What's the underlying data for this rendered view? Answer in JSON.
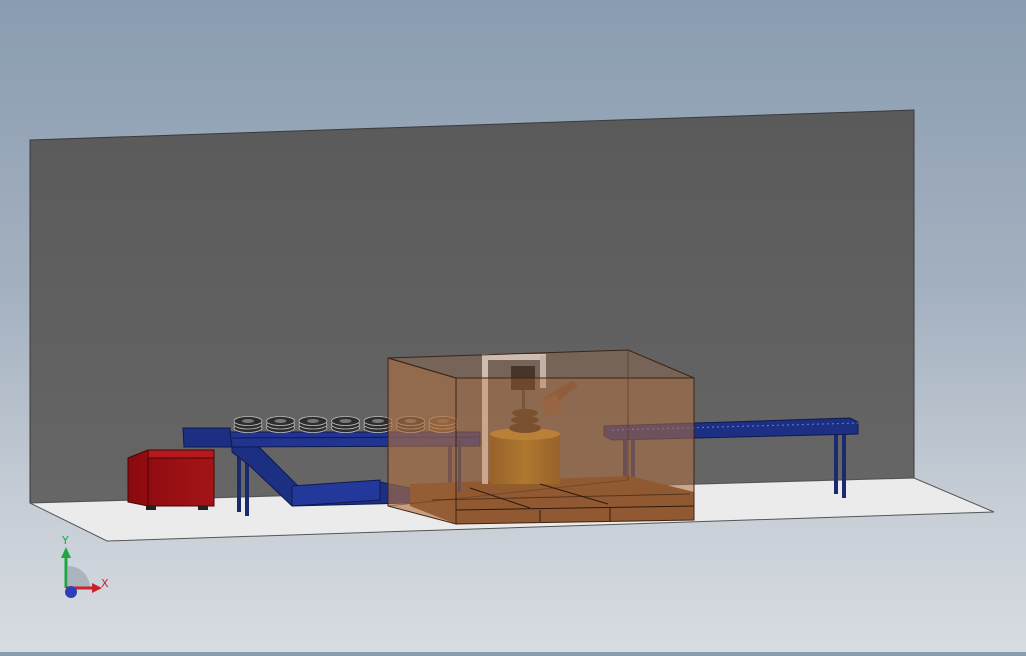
{
  "viewport": {
    "background_top": "#8a9cb1",
    "background_bottom": "#d7dce1"
  },
  "scene": {
    "back_wall_color": "#606060",
    "floor_color": "#ebebeb",
    "enclosure_color": "#b07040",
    "conveyor_color": "#1c2f82",
    "cabinet_color": "#9b0e12",
    "drum_color": "#a8761c",
    "coil_color": "#2d2d2d",
    "coil_count_on_conveyor": 7
  },
  "triad": {
    "x_label": "X",
    "y_label": "Y",
    "x_color": "#c8252a",
    "y_color": "#1ea640",
    "z_color": "#2b3fb8"
  }
}
